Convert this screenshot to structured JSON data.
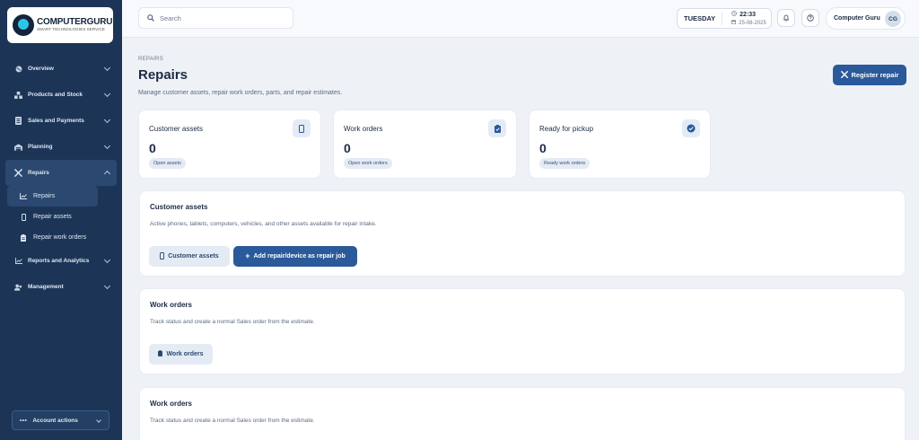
{
  "logo": {
    "name": "COMPUTERGURU",
    "tagline": "SMART TECHNOLOGIES SERVICE"
  },
  "sidebar": {
    "items": [
      {
        "label": "Overview",
        "icon": "globe-icon"
      },
      {
        "label": "Products and Stock",
        "icon": "boxes-icon"
      },
      {
        "label": "Sales and Payments",
        "icon": "receipt-icon"
      },
      {
        "label": "Planning",
        "icon": "truck-icon"
      },
      {
        "label": "Repairs",
        "icon": "tools-icon"
      },
      {
        "label": "Reports and Analytics",
        "icon": "chart-icon"
      },
      {
        "label": "Management",
        "icon": "users-icon"
      }
    ],
    "sub_items": [
      {
        "label": "Repairs",
        "icon": "chart-line-icon"
      },
      {
        "label": "Repair assets",
        "icon": "phone-icon"
      },
      {
        "label": "Repair work orders",
        "icon": "clipboard-icon"
      }
    ],
    "account": "Account actions"
  },
  "header": {
    "search_placeholder": "Search",
    "day": "TUESDAY",
    "time": "22:33",
    "date": "25-08-2025",
    "user_name": "Computer Guru",
    "user_initials": "CG"
  },
  "page": {
    "breadcrumb": "REPAIRS",
    "title": "Repairs",
    "description": "Manage customer assets, repair work orders, parts, and repair estimates.",
    "register_label": "Register repair"
  },
  "stats": [
    {
      "title": "Customer assets",
      "value": "0",
      "badge": "Open assets",
      "icon": "phone-icon"
    },
    {
      "title": "Work orders",
      "value": "0",
      "badge": "Open work orders",
      "icon": "clipboard-check-icon"
    },
    {
      "title": "Ready for pickup",
      "value": "0",
      "badge": "Ready work orders",
      "icon": "check-circle-icon"
    }
  ],
  "sections": [
    {
      "title": "Customer assets",
      "description": "Active phones, tablets, computers, vehicles, and other assets available for repair intake.",
      "button": "Customer assets",
      "button2": "Add repair/device as repair job"
    },
    {
      "title": "Work orders",
      "description": "Track status and create a normal Sales order from the estimate.",
      "button": "Work orders"
    },
    {
      "title": "Work orders",
      "description": "Track status and create a normal Sales order from the estimate."
    }
  ],
  "colors": {
    "sidebar": "#1c3557",
    "primary": "#2a5a9a",
    "background": "#eef2f7"
  }
}
